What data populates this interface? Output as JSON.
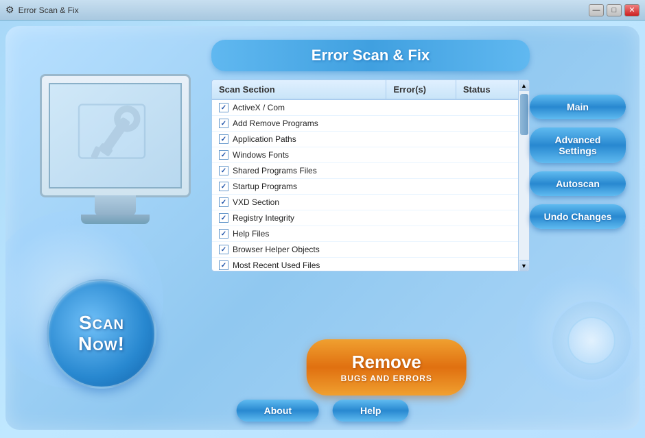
{
  "titlebar": {
    "title": "Error Scan & Fix",
    "icon": "⚙",
    "min_label": "—",
    "max_label": "□",
    "close_label": "✕"
  },
  "app": {
    "title": "Error Scan & Fix"
  },
  "table": {
    "headers": {
      "scan_section": "Scan Section",
      "errors": "Error(s)",
      "status": "Status"
    },
    "rows": [
      {
        "label": "ActiveX / Com",
        "checked": true,
        "errors": "",
        "status": ""
      },
      {
        "label": "Add Remove Programs",
        "checked": true,
        "errors": "",
        "status": ""
      },
      {
        "label": "Application Paths",
        "checked": true,
        "errors": "",
        "status": ""
      },
      {
        "label": "Windows Fonts",
        "checked": true,
        "errors": "",
        "status": ""
      },
      {
        "label": "Shared Programs Files",
        "checked": true,
        "errors": "",
        "status": ""
      },
      {
        "label": "Startup Programs",
        "checked": true,
        "errors": "",
        "status": ""
      },
      {
        "label": "VXD Section",
        "checked": true,
        "errors": "",
        "status": ""
      },
      {
        "label": "Registry Integrity",
        "checked": true,
        "errors": "",
        "status": ""
      },
      {
        "label": "Help Files",
        "checked": true,
        "errors": "",
        "status": ""
      },
      {
        "label": "Browser Helper Objects",
        "checked": true,
        "errors": "",
        "status": ""
      },
      {
        "label": "Most Recent Used Files",
        "checked": true,
        "errors": "",
        "status": ""
      }
    ]
  },
  "buttons": {
    "main": "Main",
    "advanced_settings": "Advanced Settings",
    "autoscan": "Autoscan",
    "undo_changes": "Undo Changes",
    "scan_now_line1": "Scan",
    "scan_now_line2": "Now!",
    "remove_main": "Remove",
    "remove_sub": "BUGS AND ERRORS",
    "about": "About",
    "help": "Help"
  }
}
